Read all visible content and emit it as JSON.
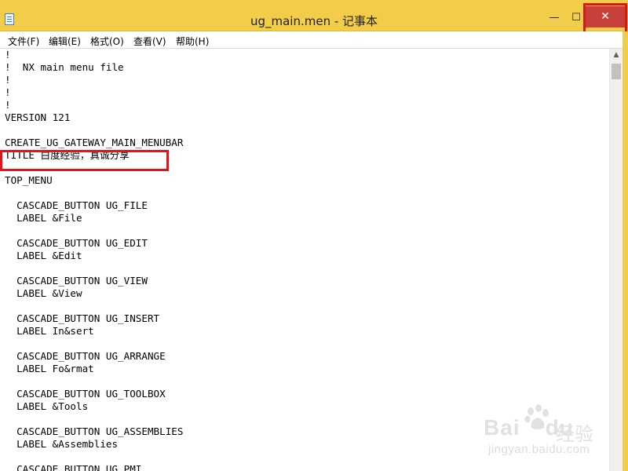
{
  "window": {
    "title": "ug_main.men - 记事本",
    "minimize_glyph": "—",
    "maximize_glyph": "☐",
    "close_glyph": "✕",
    "icon": "notepad-icon",
    "accent_color": "#f2cd4a",
    "close_color": "#c7413a",
    "highlight_color": "#e0141b"
  },
  "menubar": {
    "items": [
      {
        "label": "文件(F)"
      },
      {
        "label": "编辑(E)"
      },
      {
        "label": "格式(O)"
      },
      {
        "label": "查看(V)"
      },
      {
        "label": "帮助(H)"
      }
    ]
  },
  "editor": {
    "lines": [
      "!",
      "!  NX main menu file",
      "!",
      "!",
      "!",
      "VERSION 121",
      "",
      "CREATE_UG_GATEWAY_MAIN_MENUBAR",
      "TITLE 白度经验，真诚分享",
      "",
      "TOP_MENU",
      "",
      "  CASCADE_BUTTON UG_FILE",
      "  LABEL &File",
      "",
      "  CASCADE_BUTTON UG_EDIT",
      "  LABEL &Edit",
      "",
      "  CASCADE_BUTTON UG_VIEW",
      "  LABEL &View",
      "",
      "  CASCADE_BUTTON UG_INSERT",
      "  LABEL In&sert",
      "",
      "  CASCADE_BUTTON UG_ARRANGE",
      "  LABEL Fo&rmat",
      "",
      "  CASCADE_BUTTON UG_TOOLBOX",
      "  LABEL &Tools",
      "",
      "  CASCADE_BUTTON UG_ASSEMBLIES",
      "  LABEL &Assemblies",
      "",
      "  CASCADE_BUTTON UG_PMI"
    ]
  },
  "scrollbar": {
    "up_glyph": "▲"
  },
  "watermark": {
    "brand": "Bai",
    "brand2": "du",
    "cn": "经验",
    "url": "jingyan.baidu.com"
  }
}
